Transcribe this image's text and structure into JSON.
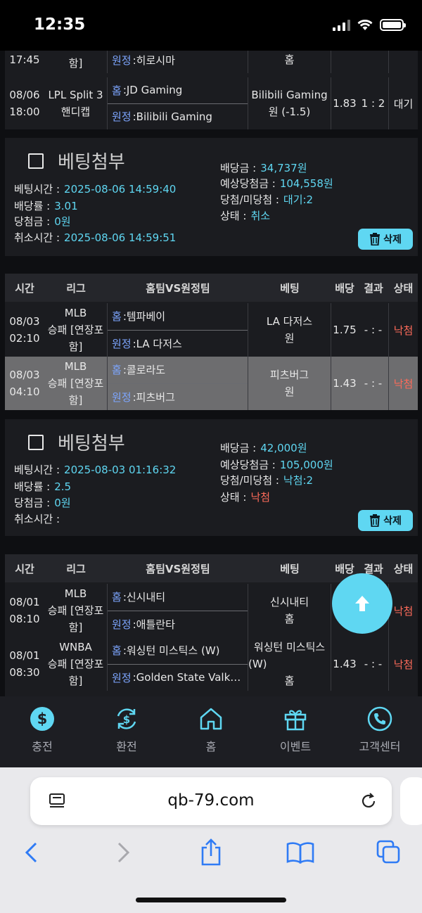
{
  "status_bar": {
    "time": "12:35"
  },
  "bet1": {
    "partial_row": {
      "time": "17:45",
      "league": "함]",
      "away_label": "원정",
      "away_team": ":히로시마",
      "bet": "홈"
    },
    "row": {
      "date": "08/06",
      "time": "18:00",
      "league_line1": "LPL Split 3",
      "league_line2": "핸디캡",
      "home_label": "홈",
      "home_team": ":JD Gaming",
      "away_label": "원정",
      "away_team": ":Bilibili Gaming",
      "bet_line1": "Bilibili Gaming",
      "bet_line2": "원 (-1.5)",
      "odds": "1.83",
      "result": "1 : 2",
      "status": "대기"
    },
    "summary": {
      "title": "베팅첨부",
      "bet_time_label": "베팅시간 :",
      "bet_time": "2025-08-06 14:59:40",
      "odds_label": "배당률 :",
      "odds": "3.01",
      "win_label": "당첨금 :",
      "win": "0원",
      "cancel_label": "취소시간 :",
      "cancel": "2025-08-06 14:59:51",
      "stake_label": "배당금 :",
      "stake": "34,737원",
      "expected_label": "예상당첨금 :",
      "expected": "104,558원",
      "wl_label": "당첨/미당첨 :",
      "wl": "대기:2",
      "state_label": "상태 :",
      "state": "취소",
      "delete_label": "삭제"
    }
  },
  "table_header": {
    "time": "시간",
    "league": "리그",
    "match": "홈팀VS원정팀",
    "bet": "베팅",
    "odds": "배당",
    "result": "결과",
    "status": "상태"
  },
  "bet2": {
    "rows": [
      {
        "date": "08/03",
        "time": "02:10",
        "league_line1": "MLB",
        "league_line2": "승패 [연장포",
        "league_line3": "함]",
        "home_label": "홈",
        "home_team": ":템파베이",
        "away_label": "원정",
        "away_team": ":LA 다저스",
        "bet_line1": "LA 다저스",
        "bet_line2": "원",
        "odds": "1.75",
        "result": "- : -",
        "status": "낙첨"
      },
      {
        "date": "08/03",
        "time": "04:10",
        "league_line1": "MLB",
        "league_line2": "승패 [연장포",
        "league_line3": "함]",
        "home_label": "홈",
        "home_team": ":콜로라도",
        "away_label": "원정",
        "away_team": ":피츠버그",
        "bet_line1": "피츠버그",
        "bet_line2": "원",
        "odds": "1.43",
        "result": "- : -",
        "status": "낙첨"
      }
    ],
    "summary": {
      "title": "베팅첨부",
      "bet_time_label": "베팅시간 :",
      "bet_time": "2025-08-03 01:16:32",
      "odds_label": "배당률 :",
      "odds": "2.5",
      "win_label": "당첨금 :",
      "win": "0원",
      "cancel_label": "취소시간 :",
      "cancel": "",
      "stake_label": "배당금 :",
      "stake": "42,000원",
      "expected_label": "예상당첨금 :",
      "expected": "105,000원",
      "wl_label": "당첨/미당첨 :",
      "wl": "낙첨:2",
      "state_label": "상태 :",
      "state": "낙첨",
      "delete_label": "삭제"
    }
  },
  "bet3": {
    "rows": [
      {
        "date": "08/01",
        "time": "08:10",
        "league_line1": "MLB",
        "league_line2": "승패 [연장포",
        "league_line3": "함]",
        "home_label": "홈",
        "home_team": ":신시내티",
        "away_label": "원정",
        "away_team": ":애틀란타",
        "bet_line1": "신시내티",
        "bet_line2": "홈",
        "odds": "",
        "result": "",
        "status": "낙첨"
      },
      {
        "date": "08/01",
        "time": "08:30",
        "league_line1": "WNBA",
        "league_line2": "승패 [연장포",
        "league_line3": "함]",
        "home_label": "홈",
        "home_team": ":워싱턴 미스틱스 (W)",
        "away_label": "원정",
        "away_team": ":Golden State Valk…",
        "bet_line1": "워싱턴 미스틱스",
        "bet_line2": "(W)",
        "bet_line3": "홈",
        "odds": "1.43",
        "result": "- : -",
        "status": "낙첨"
      }
    ]
  },
  "bottom_nav": [
    {
      "label": "충전",
      "icon": "dollar-icon"
    },
    {
      "label": "환전",
      "icon": "exchange-icon"
    },
    {
      "label": "홈",
      "icon": "home-icon"
    },
    {
      "label": "이벤트",
      "icon": "gift-icon"
    },
    {
      "label": "고객센터",
      "icon": "phone-icon"
    }
  ],
  "browser": {
    "url": "qb-79.com"
  }
}
